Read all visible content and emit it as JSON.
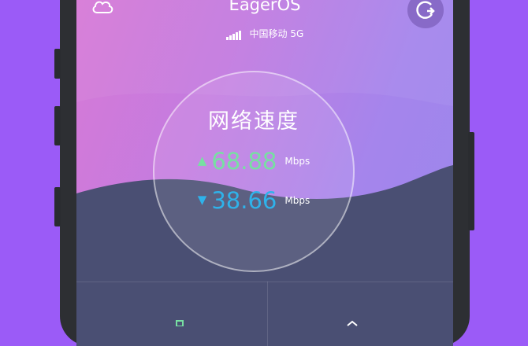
{
  "app": {
    "title": "EagerOS"
  },
  "status": {
    "carrier": "中国移动 5G"
  },
  "speed": {
    "title": "网络速度",
    "upload": {
      "value": "68.88",
      "unit": "Mbps"
    },
    "download": {
      "value": "38.66",
      "unit": "Mbps"
    }
  },
  "icons": {
    "left": "settings-cloud-icon",
    "right": "refresh-icon",
    "upload": "arrow-up-icon",
    "download": "arrow-down-icon"
  },
  "colors": {
    "background": "#9b5bf7",
    "upload": "#77e0a2",
    "download": "#2fb2ea",
    "wave": "#4a4f73"
  }
}
